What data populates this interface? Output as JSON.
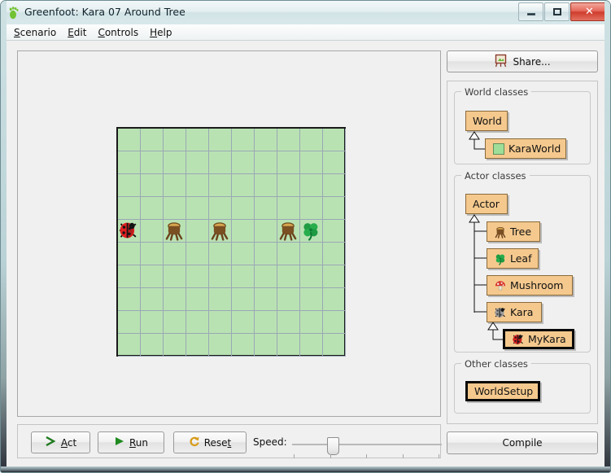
{
  "window": {
    "title": "Greenfoot: Kara 07 Around Tree",
    "icon": "greenfoot-footprint-icon",
    "minimize_label": "",
    "maximize_label": "",
    "close_label": "✕"
  },
  "menubar": {
    "items": [
      {
        "label": "Scenario",
        "mnemonic": "S",
        "rest": "cenario"
      },
      {
        "label": "Edit",
        "mnemonic": "E",
        "rest": "dit"
      },
      {
        "label": "Controls",
        "mnemonic": "C",
        "rest": "ontrols"
      },
      {
        "label": "Help",
        "mnemonic": "H",
        "rest": "elp"
      }
    ]
  },
  "world": {
    "columns": 10,
    "rows": 10,
    "cell_size": 28,
    "background_color": "#b9e2b3",
    "grid_line_color": "#9aa8b4",
    "border_color": "#1a1a1a",
    "actors": [
      {
        "name": "kara-ladybug-actor",
        "type": "MyKara",
        "icon": "ladybug-icon",
        "col": 0,
        "row": 4
      },
      {
        "name": "tree-actor",
        "type": "Tree",
        "icon": "tree-stump-icon",
        "col": 2,
        "row": 4
      },
      {
        "name": "tree-actor",
        "type": "Tree",
        "icon": "tree-stump-icon",
        "col": 4,
        "row": 4
      },
      {
        "name": "tree-actor",
        "type": "Tree",
        "icon": "tree-stump-icon",
        "col": 7,
        "row": 4
      },
      {
        "name": "leaf-actor",
        "type": "Leaf",
        "icon": "clover-leaf-icon",
        "col": 8,
        "row": 4
      }
    ]
  },
  "controls": {
    "act": {
      "label": "Act",
      "mnemonic": "A",
      "rest": "ct",
      "icon": "act-arrow-icon"
    },
    "run": {
      "label": "Run",
      "mnemonic": "R",
      "rest": "un",
      "icon": "play-icon"
    },
    "reset": {
      "label": "Reset",
      "mnemonic": "t",
      "pre": "Rese",
      "icon": "reset-icon"
    },
    "speed_label": "Speed:",
    "speed_value": 25,
    "speed_ticks": 5
  },
  "sidebar": {
    "share_button": {
      "label": "Share...",
      "icon": "share-easel-icon"
    },
    "compile_button": {
      "label": "Compile"
    },
    "groups": [
      {
        "title": "World classes",
        "classes": [
          {
            "name": "World",
            "icon": null,
            "selected": false
          },
          {
            "name": "KaraWorld",
            "icon": "green-world-icon",
            "selected": false
          }
        ]
      },
      {
        "title": "Actor classes",
        "classes": [
          {
            "name": "Actor",
            "icon": null,
            "selected": false
          },
          {
            "name": "Tree",
            "icon": "tree-stump-icon",
            "selected": false
          },
          {
            "name": "Leaf",
            "icon": "clover-leaf-icon",
            "selected": false
          },
          {
            "name": "Mushroom",
            "icon": "mushroom-icon",
            "selected": false
          },
          {
            "name": "Kara",
            "icon": "gray-bug-icon",
            "selected": false
          },
          {
            "name": "MyKara",
            "icon": "ladybug-icon",
            "selected": true
          }
        ]
      },
      {
        "title": "Other classes",
        "classes": [
          {
            "name": "WorldSetup",
            "icon": null,
            "selected": true
          }
        ]
      }
    ]
  },
  "colors": {
    "class_box_fill": "#f5c98e",
    "class_box_border": "#8a6a3a",
    "world_green": "#b9e2b3",
    "titlebar": "#dbe8ea",
    "close_button": "#cf3c2c"
  }
}
